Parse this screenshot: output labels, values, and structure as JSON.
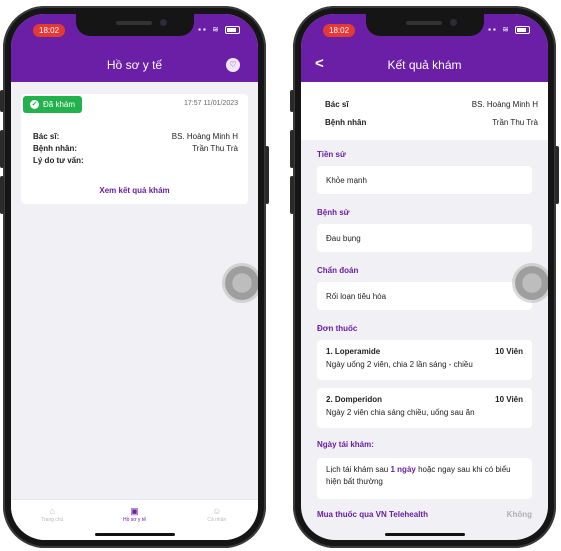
{
  "left_phone": {
    "status_time": "18:02",
    "header_title": "Hồ sơ y tế",
    "record": {
      "status_badge": "Đã khám",
      "datetime": "17:57 11/01/2023",
      "doctor_label": "Bác sĩ:",
      "doctor_value": "BS. Hoàng Minh H",
      "patient_label": "Bệnh nhân:",
      "patient_value": "Trần Thu Trà",
      "reason_label": "Lý do tư vấn:",
      "reason_value": "",
      "view_result_link": "Xem kết quả khám"
    },
    "tabs": [
      {
        "label": "Trang chủ",
        "icon": "home-icon"
      },
      {
        "label": "Hồ sơ y tế",
        "icon": "record-icon"
      },
      {
        "label": "Cá nhân",
        "icon": "user-icon"
      }
    ]
  },
  "right_phone": {
    "status_time": "18:02",
    "header_title": "Kết quả khám",
    "doctor_label": "Bác sĩ",
    "doctor_value": "BS. Hoàng Minh H",
    "patient_label": "Bệnh nhân",
    "patient_value": "Trần Thu Trà",
    "history_title": "Tiền sử",
    "history_value": "Khỏe mạnh",
    "illness_title": "Bệnh sử",
    "illness_value": "Đau bụng",
    "diagnosis_title": "Chẩn đoán",
    "diagnosis_value": "Rối loạn tiêu hóa",
    "prescription_title": "Đơn thuốc",
    "prescriptions": [
      {
        "name": "1. Loperamide",
        "qty": "10 Viên",
        "instructions": "Ngày uống 2 viên, chia 2 lần sáng - chiều"
      },
      {
        "name": "2. Domperidon",
        "qty": "10 Viên",
        "instructions": "Ngày 2 viên chia sáng chiều, uống sau ăn"
      }
    ],
    "followup_title": "Ngày tái khám:",
    "followup_text_before": "Lịch tái khám sau",
    "followup_highlight": "1 ngày",
    "followup_text_after": "hoặc ngay sau khi có biểu hiện bất thường",
    "buy_label": "Mua thuốc qua VN Telehealth",
    "buy_value": "Không"
  },
  "colors": {
    "primary": "#6a1fa6",
    "success": "#22b14c",
    "status_time_bg": "#e53935"
  }
}
